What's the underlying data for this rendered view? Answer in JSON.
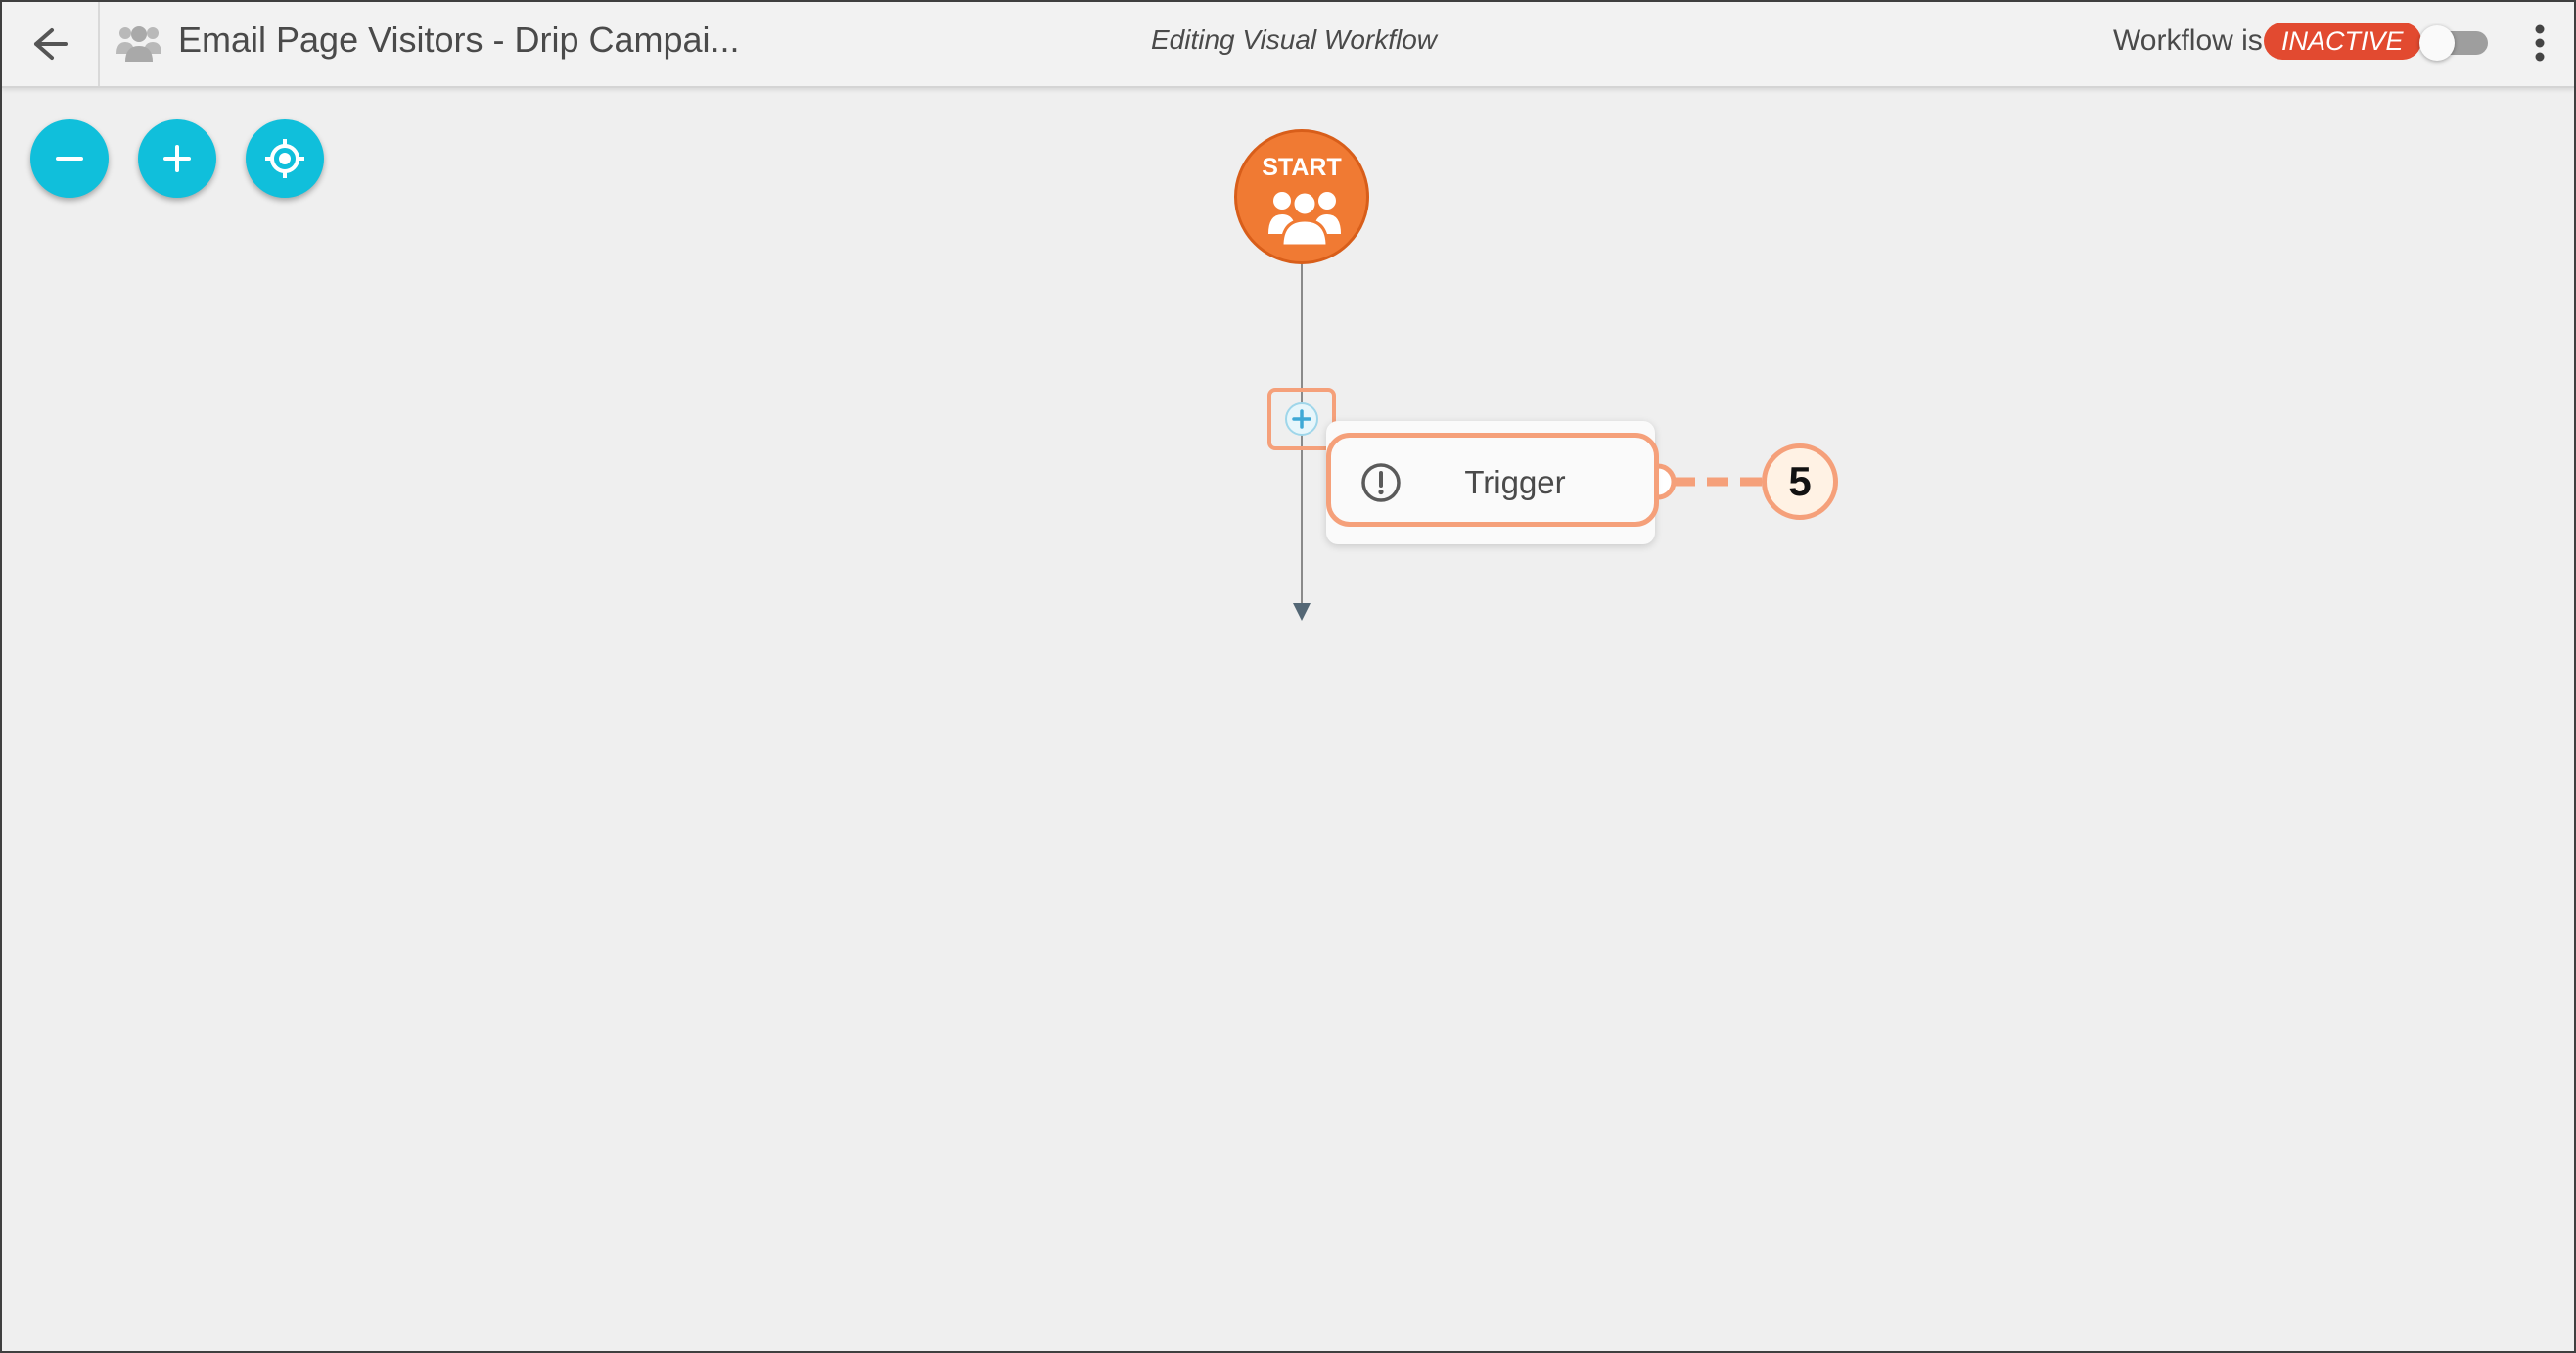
{
  "header": {
    "back_icon": "arrow-left-icon",
    "workflow_icon": "users-group-icon",
    "title": "Email Page Visitors - Drip Campai...",
    "editing_label": "Editing Visual Workflow",
    "status_prefix": "Workflow is",
    "status_badge": "INACTIVE",
    "toggle_on": false,
    "menu_icon": "vertical-dots-icon"
  },
  "canvas_controls": [
    {
      "name": "zoom-out-button",
      "icon": "minus-icon"
    },
    {
      "name": "zoom-in-button",
      "icon": "plus-icon"
    },
    {
      "name": "center-view-button",
      "icon": "crosshair-icon"
    }
  ],
  "flow": {
    "start_label": "START",
    "start_icon": "users-group-icon",
    "add_step_icon": "plus-icon",
    "trigger": {
      "label": "Trigger",
      "icon": "exclamation-circle-icon"
    },
    "callout_number": "5",
    "end_icon": "arrow-down-icon"
  },
  "colors": {
    "canvas_bg": "#efefef",
    "header_bg": "#f2f2f2",
    "accent_cyan": "#10bfdb",
    "start_orange": "#f07a33",
    "inactive_red": "#e24a30",
    "highlight_orange": "#f5a07a"
  }
}
